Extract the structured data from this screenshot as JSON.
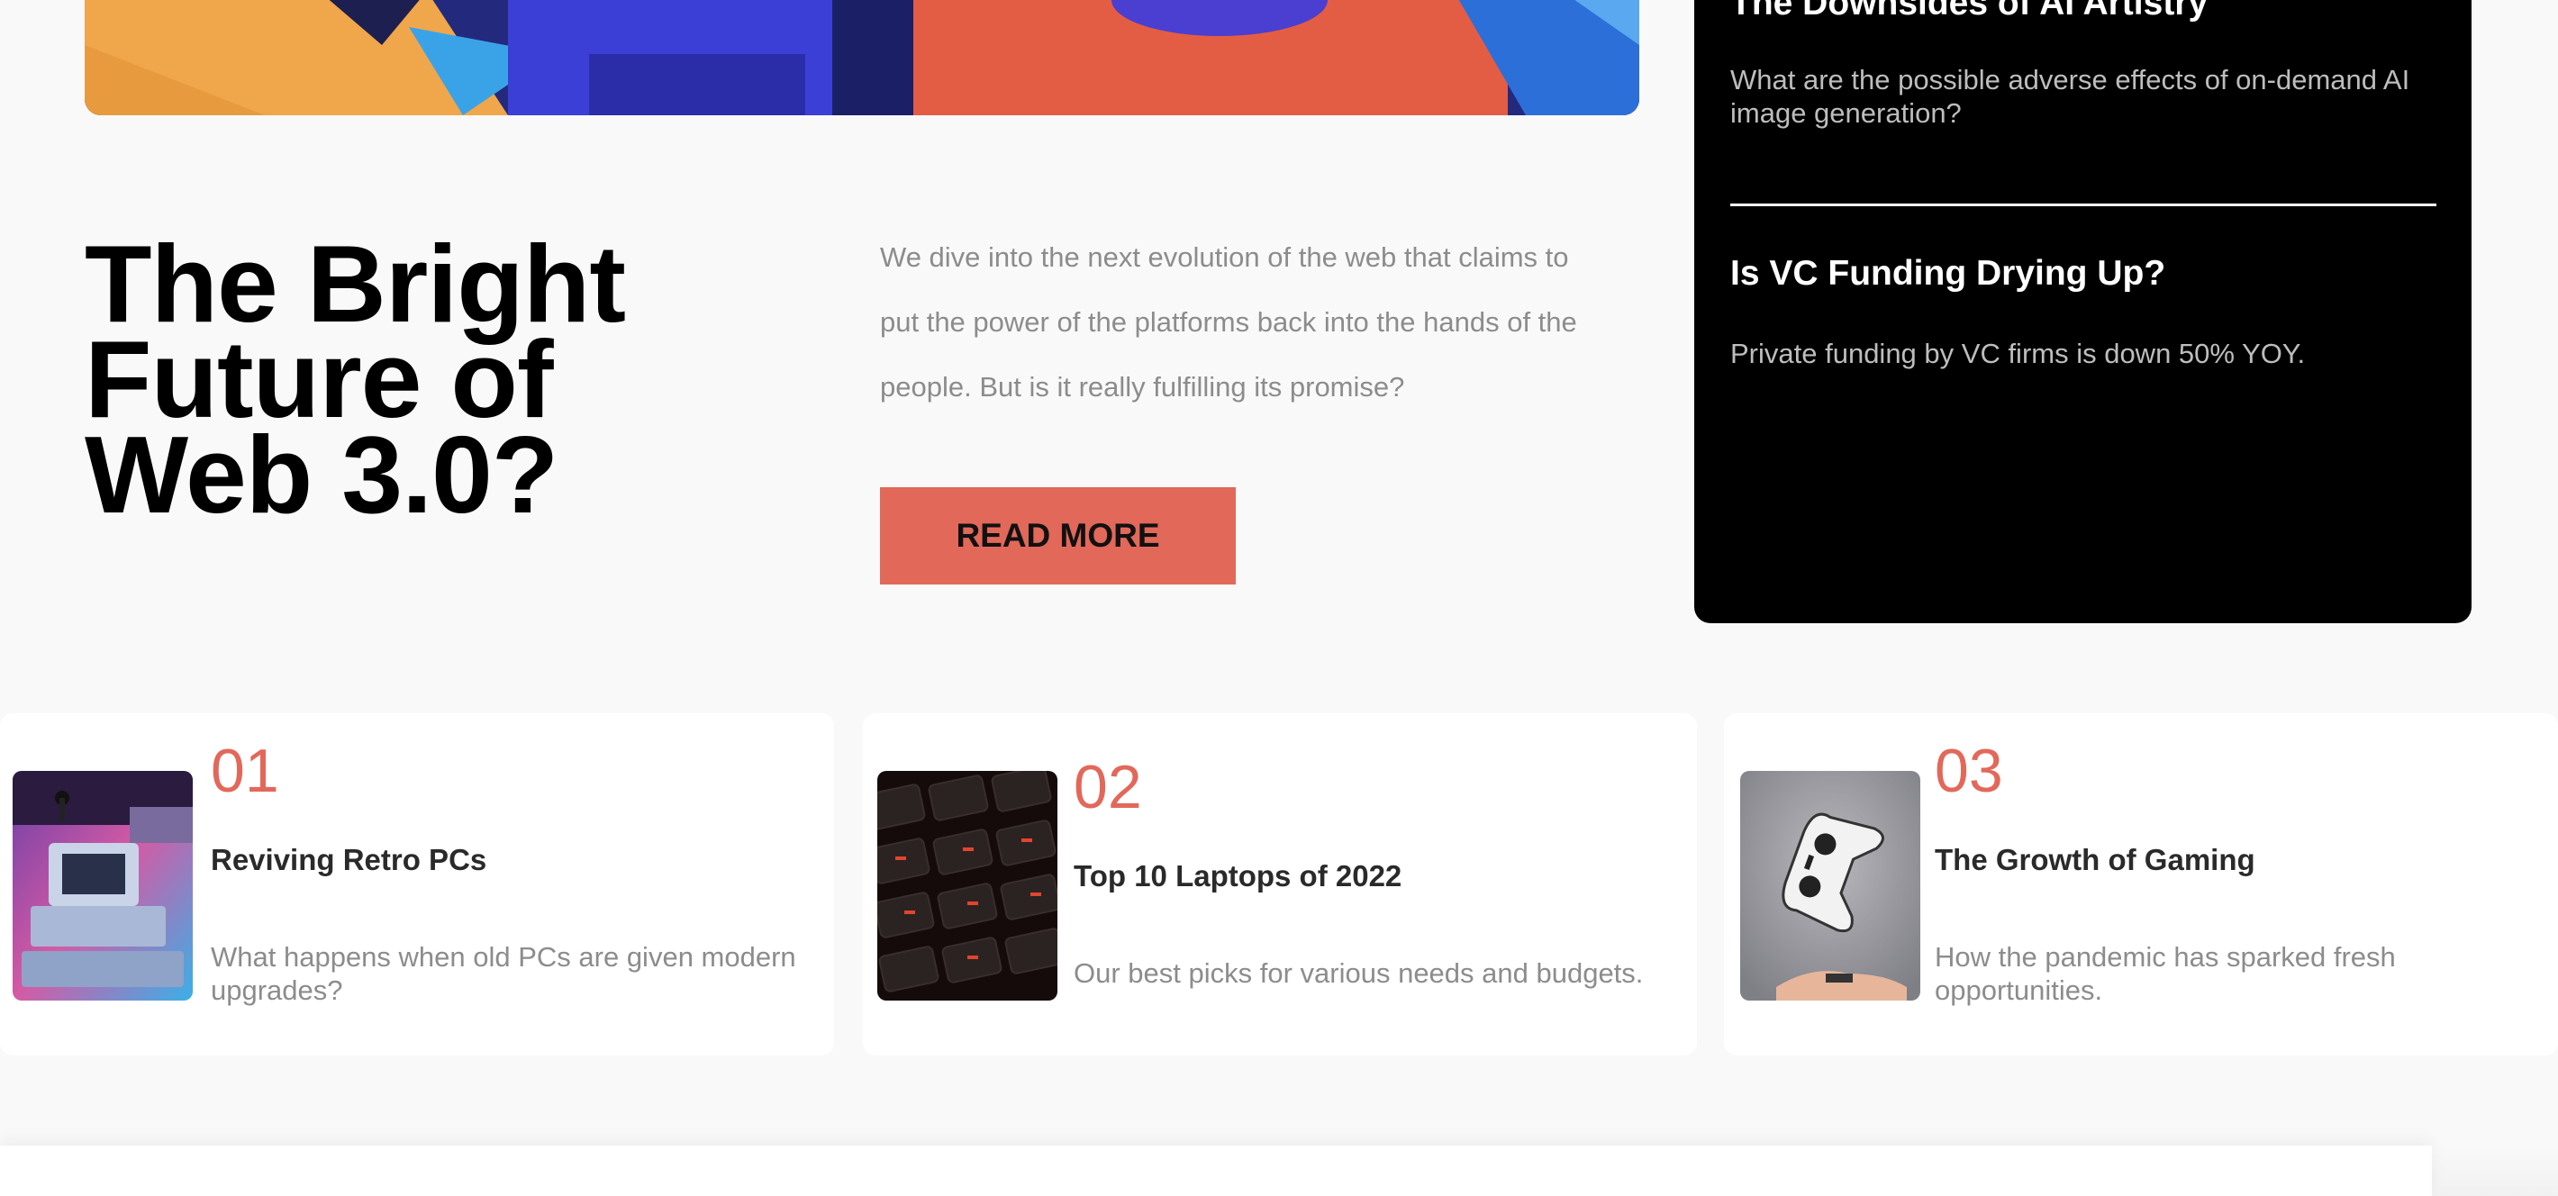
{
  "hero": {
    "title": "The Bright Future of Web 3.0?",
    "description": "We dive into the next evolution of the web that claims to put the power of the platforms back into the hands of the people. But is it really fulfilling its promise?",
    "cta_label": "READ MORE",
    "accent_color": "#e2685a"
  },
  "sidebar": {
    "items": [
      {
        "title": "The Downsides of AI Artistry",
        "description": "What are the possible adverse effects of on-demand AI image generation?"
      },
      {
        "title": "Is VC Funding Drying Up?",
        "description": "Private funding by VC firms is down 50% YOY."
      }
    ]
  },
  "cards": [
    {
      "number": "01",
      "title": "Reviving Retro PCs",
      "description": "What happens when old PCs are given modern upgrades?",
      "image": "retro-pc-image"
    },
    {
      "number": "02",
      "title": "Top 10 Laptops of 2022",
      "description": "Our best picks for various needs and budgets.",
      "image": "laptop-keyboard-image"
    },
    {
      "number": "03",
      "title": "The Growth of Gaming",
      "description": "How the pandemic has sparked fresh opportunities.",
      "image": "game-controller-image"
    }
  ]
}
